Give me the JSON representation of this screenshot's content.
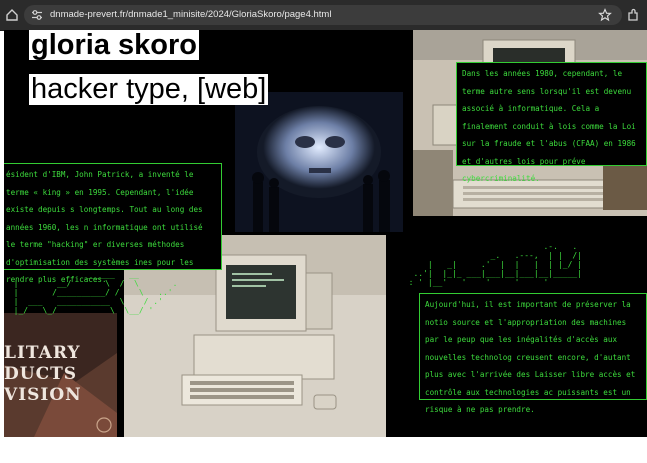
{
  "browser": {
    "url": "dnmade-prevert.fr/dnmade1_minisite/2024/GloriaSkoro/page4.html"
  },
  "header": {
    "name": "gloria skoro",
    "subtitle": "hacker type, [web]"
  },
  "texts": {
    "box_left": "ésident d'IBM, John Patrick, a inventé le terme « king » en 1995. Cependant, l'idée existe depuis s longtemps. Tout au long des années 1960, les n informatique ont utilisé le terme \"hacking\" er diverses méthodes d'optimisation des systèmes ines pour les rendre plus efficaces.",
    "box_top_right": "Dans les années 1980, cependant, le terme autre sens lorsqu'il est devenu associé à informatique. Cela a finalement conduit à lois comme la Loi sur la fraude et l'abus (CFAA) en 1986 et d'autres lois pour préve cybercriminalité.",
    "box_bottom_right": "Aujourd'hui, il est important de préserver la notio source et l'appropriation des machines par le peup que les inégalités d'accès aux nouvelles technolog creusent encore, d'autant plus avec l'arrivée des Laisser libre accès et contrôle aux technologies ac puissants est un risque à ne pas prendre."
  },
  "images": {
    "military_sign": "LITARY DUCTS VISION"
  },
  "colors": {
    "accent_green": "#3ddc3d",
    "page_background": "#000000"
  }
}
